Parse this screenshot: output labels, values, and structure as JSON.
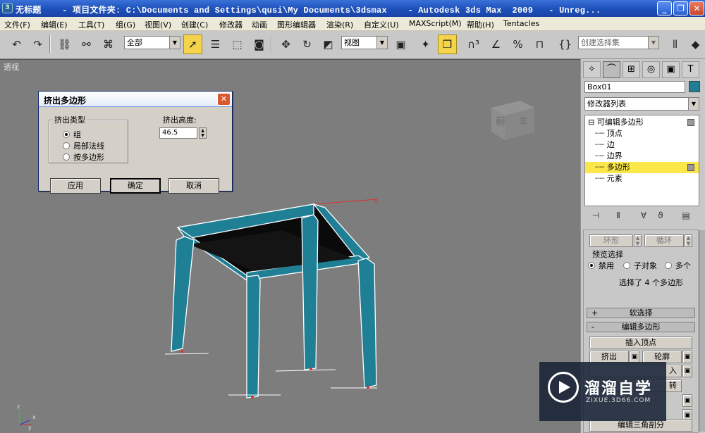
{
  "window": {
    "title": "无标题    - 项目文件夹: C:\\Documents and Settings\\qusi\\My Documents\\3dsmax    - Autodesk 3ds Max  2009   - Unreg...",
    "minimize": "_",
    "restore": "❐",
    "close": "✕"
  },
  "menu": [
    "文件(F)",
    "编辑(E)",
    "工具(T)",
    "组(G)",
    "视图(V)",
    "创建(C)",
    "修改器",
    "动画",
    "图形编辑器",
    "渲染(R)",
    "自定义(U)",
    "MAXScript(M)",
    "帮助(H)",
    "Tentacles"
  ],
  "toolbar": {
    "selection_filter": "全部",
    "ref_coord": "视图",
    "named_selection_placeholder": "创建选择集"
  },
  "viewport": {
    "label": "透视",
    "gizmo_front": "前",
    "gizmo_side": "左",
    "axis_z": "z",
    "axis_x": "x",
    "axis_y": "y"
  },
  "dialog": {
    "title": "挤出多边形",
    "close": "✕",
    "group_label": "挤出类型",
    "options": [
      "组",
      "局部法线",
      "按多边形"
    ],
    "selected_option": "组",
    "height_label": "挤出高度:",
    "height_value": "46.5",
    "buttons": {
      "apply": "应用",
      "ok": "确定",
      "cancel": "取消"
    }
  },
  "command_panel": {
    "object_name": "Box01",
    "object_color": "#1e7f95",
    "modifier_list": "修改器列表",
    "stack": [
      {
        "label": "可编辑多边形",
        "prefix": "⊟ ",
        "indent": 0
      },
      {
        "label": "顶点",
        "prefix": "┈┈ ",
        "indent": 1
      },
      {
        "label": "边",
        "prefix": "┈┈ ",
        "indent": 1
      },
      {
        "label": "边界",
        "prefix": "┈┈ ",
        "indent": 1
      },
      {
        "label": "多边形",
        "prefix": "┈┈ ",
        "indent": 1
      },
      {
        "label": "元素",
        "prefix": "┈┈ ",
        "indent": 1
      }
    ],
    "highlighted_level": "多边形",
    "ring_label": "环形",
    "loop_label": "循环",
    "preview_label": "预览选择",
    "preview_options": [
      "禁用",
      "子对象",
      "多个"
    ],
    "preview_selected": "禁用",
    "selection_status": "选择了 4 个多边形",
    "rollouts": [
      {
        "sign": "+",
        "label": "软选择"
      },
      {
        "sign": "-",
        "label": "编辑多边形"
      }
    ],
    "insert_vertex": "插入顶点",
    "extrude": "挤出",
    "outline": "轮廓",
    "partial_right_1": "入",
    "partial_right_2": "转",
    "edit_triangulation": "编辑三角剖分"
  },
  "watermark": {
    "name": "溜溜自学",
    "url": "ZIXUE.3D66.COM"
  }
}
